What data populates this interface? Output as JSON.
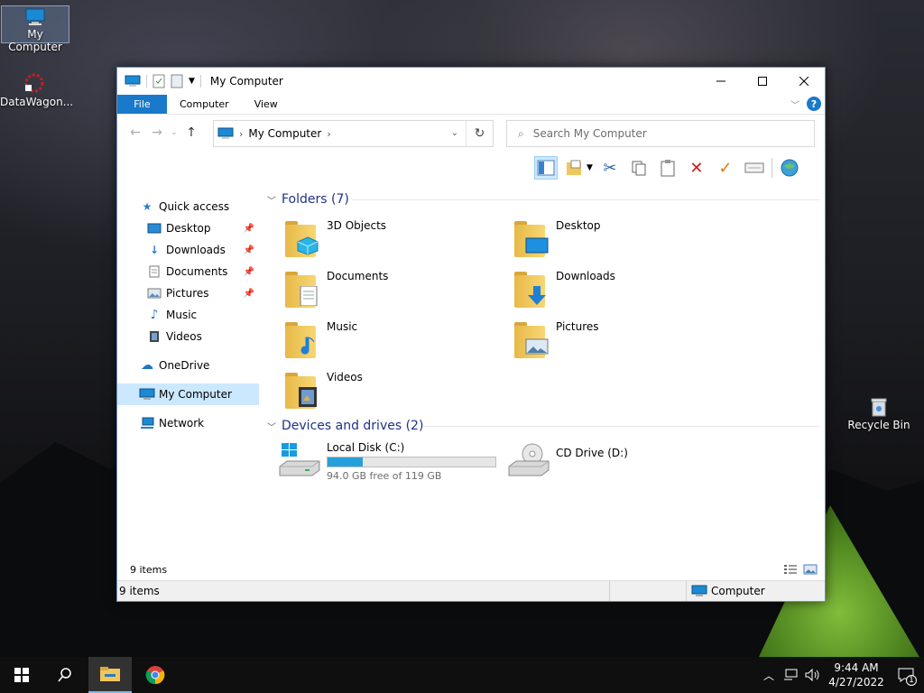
{
  "desktop": {
    "icons": [
      {
        "label": "My Computer"
      },
      {
        "label": "DataWagon..."
      },
      {
        "label": "Recycle Bin"
      }
    ]
  },
  "window": {
    "title": "My Computer",
    "ribbon_tabs": [
      "File",
      "Computer",
      "View"
    ],
    "address": {
      "path": "My Computer"
    },
    "search": {
      "placeholder": "Search My Computer"
    }
  },
  "navpane": {
    "items": [
      {
        "label": "Quick access",
        "icon": "star-icon"
      },
      {
        "label": "Desktop",
        "icon": "desktop-icon",
        "pinned": true
      },
      {
        "label": "Downloads",
        "icon": "download-icon",
        "pinned": true
      },
      {
        "label": "Documents",
        "icon": "document-icon",
        "pinned": true
      },
      {
        "label": "Pictures",
        "icon": "pictures-icon",
        "pinned": true
      },
      {
        "label": "Music",
        "icon": "music-icon"
      },
      {
        "label": "Videos",
        "icon": "videos-icon"
      },
      {
        "label": "OneDrive",
        "icon": "cloud-icon"
      },
      {
        "label": "My Computer",
        "icon": "computer-icon",
        "selected": true
      },
      {
        "label": "Network",
        "icon": "network-icon"
      }
    ]
  },
  "content": {
    "folders_header": "Folders (7)",
    "folders": [
      {
        "name": "3D Objects"
      },
      {
        "name": "Desktop"
      },
      {
        "name": "Documents"
      },
      {
        "name": "Downloads"
      },
      {
        "name": "Music"
      },
      {
        "name": "Pictures"
      },
      {
        "name": "Videos"
      }
    ],
    "drives_header": "Devices and drives (2)",
    "drives": [
      {
        "name": "Local Disk (C:)",
        "free_text": "94.0 GB free of 119 GB",
        "used_fraction": 0.21
      },
      {
        "name": "CD Drive (D:)"
      }
    ]
  },
  "status": {
    "items_inline": "9 items",
    "items_bar": "9 items",
    "location": "Computer"
  },
  "taskbar": {
    "time": "9:44 AM",
    "date": "4/27/2022",
    "notification_count": "1"
  },
  "colors": {
    "accent": "#1979ca",
    "selection": "#cce8ff",
    "group_header": "#1e3287",
    "drive_fill": "#26a0da"
  }
}
